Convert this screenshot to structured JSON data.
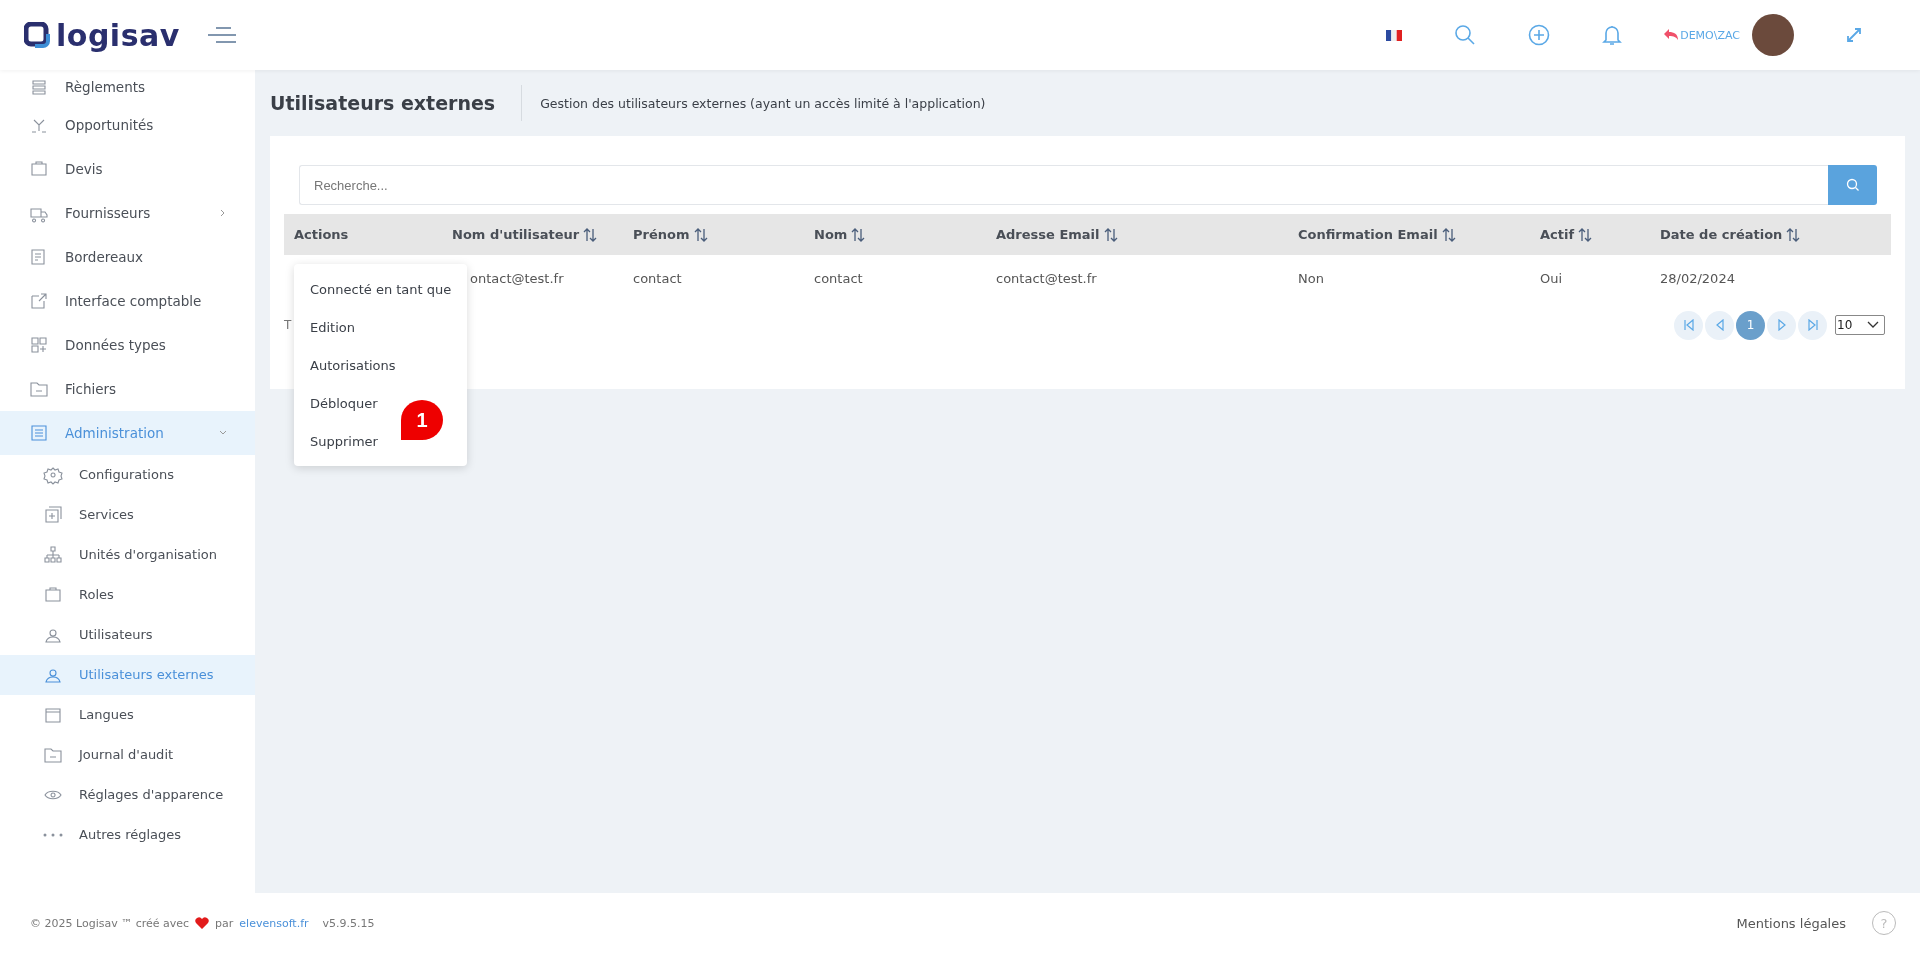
{
  "header": {
    "logo": "logisav",
    "user": "DEMO\\ZAC"
  },
  "sidebar": {
    "items": [
      {
        "label": "Règlements",
        "selected": false
      },
      {
        "label": "Opportunités",
        "selected": false
      },
      {
        "label": "Devis",
        "selected": false
      },
      {
        "label": "Fournisseurs",
        "selected": false,
        "expanded": false
      },
      {
        "label": "Bordereaux",
        "selected": false
      },
      {
        "label": "Interface comptable",
        "selected": false
      },
      {
        "label": "Données types",
        "selected": false
      },
      {
        "label": "Fichiers",
        "selected": false
      },
      {
        "label": "Administration",
        "selected": true,
        "expanded": true,
        "children": [
          {
            "label": "Configurations",
            "selected": false
          },
          {
            "label": "Services",
            "selected": false
          },
          {
            "label": "Unités d'organisation",
            "selected": false
          },
          {
            "label": "Roles",
            "selected": false
          },
          {
            "label": "Utilisateurs",
            "selected": false
          },
          {
            "label": "Utilisateurs externes",
            "selected": true
          },
          {
            "label": "Langues",
            "selected": false
          },
          {
            "label": "Journal d'audit",
            "selected": false
          },
          {
            "label": "Réglages d'apparence",
            "selected": false
          },
          {
            "label": "Autres réglages",
            "selected": false
          }
        ]
      }
    ]
  },
  "page": {
    "title": "Utilisateurs externes",
    "subtitle": "Gestion des utilisateurs externes (ayant un accès limité à l'application)"
  },
  "search": {
    "placeholder": "Recherche..."
  },
  "table": {
    "columns": [
      {
        "label": "Actions",
        "sortable": false
      },
      {
        "label": "Nom d'utilisateur",
        "sortable": true
      },
      {
        "label": "Prénom",
        "sortable": true
      },
      {
        "label": "Nom",
        "sortable": true
      },
      {
        "label": "Adresse Email",
        "sortable": true
      },
      {
        "label": "Confirmation Email",
        "sortable": true
      },
      {
        "label": "Actif",
        "sortable": true
      },
      {
        "label": "Date de création",
        "sortable": true
      }
    ],
    "rows": [
      [
        "",
        "ontact@test.fr",
        "contact",
        "contact",
        "contact@test.fr",
        "Non",
        "Oui",
        "28/02/2024"
      ]
    ],
    "total_fragment": "T"
  },
  "actions_menu": [
    "Connecté en tant que",
    "Edition",
    "Autorisations",
    "Débloquer",
    "Supprimer"
  ],
  "callout": "1",
  "pagination": {
    "pages": [
      {
        "label": "1",
        "selected": true
      }
    ],
    "page_size": "10"
  },
  "footer": {
    "copyright": "© 2025 Logisav ™ créé avec",
    "by": "par",
    "link": "elevensoft.fr",
    "version": "v5.9.5.15",
    "legal": "Mentions légales",
    "help": "?"
  }
}
